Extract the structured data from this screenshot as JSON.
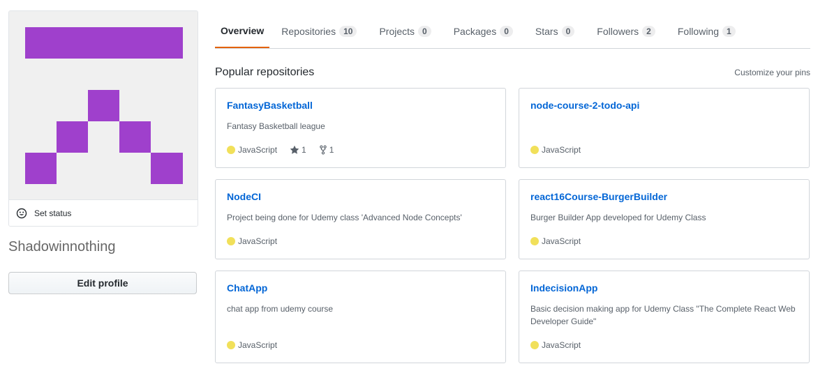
{
  "profile": {
    "set_status_label": "Set status",
    "username": "Shadowinnothing",
    "edit_profile_label": "Edit profile",
    "avatar_color": "#9f40cc"
  },
  "nav": {
    "tabs": [
      {
        "label": "Overview",
        "count": null
      },
      {
        "label": "Repositories",
        "count": "10"
      },
      {
        "label": "Projects",
        "count": "0"
      },
      {
        "label": "Packages",
        "count": "0"
      },
      {
        "label": "Stars",
        "count": "0"
      },
      {
        "label": "Followers",
        "count": "2"
      },
      {
        "label": "Following",
        "count": "1"
      }
    ],
    "accent_color": "#e36209"
  },
  "popular": {
    "title": "Popular repositories",
    "customize_label": "Customize your pins",
    "repos": [
      {
        "name": "FantasyBasketball",
        "description": "Fantasy Basketball league",
        "language": "JavaScript",
        "language_color": "#f1e05a",
        "stars": "1",
        "forks": "1"
      },
      {
        "name": "node-course-2-todo-api",
        "description": "",
        "language": "JavaScript",
        "language_color": "#f1e05a"
      },
      {
        "name": "NodeCI",
        "description": "Project being done for Udemy class 'Advanced Node Concepts'",
        "language": "JavaScript",
        "language_color": "#f1e05a"
      },
      {
        "name": "react16Course-BurgerBuilder",
        "description": "Burger Builder App developed for Udemy Class",
        "language": "JavaScript",
        "language_color": "#f1e05a"
      },
      {
        "name": "ChatApp",
        "description": "chat app from udemy course",
        "language": "JavaScript",
        "language_color": "#f1e05a"
      },
      {
        "name": "IndecisionApp",
        "description": "Basic decision making app for Udemy Class \"The Complete React Web Developer Guide\"",
        "language": "JavaScript",
        "language_color": "#f1e05a"
      }
    ]
  }
}
